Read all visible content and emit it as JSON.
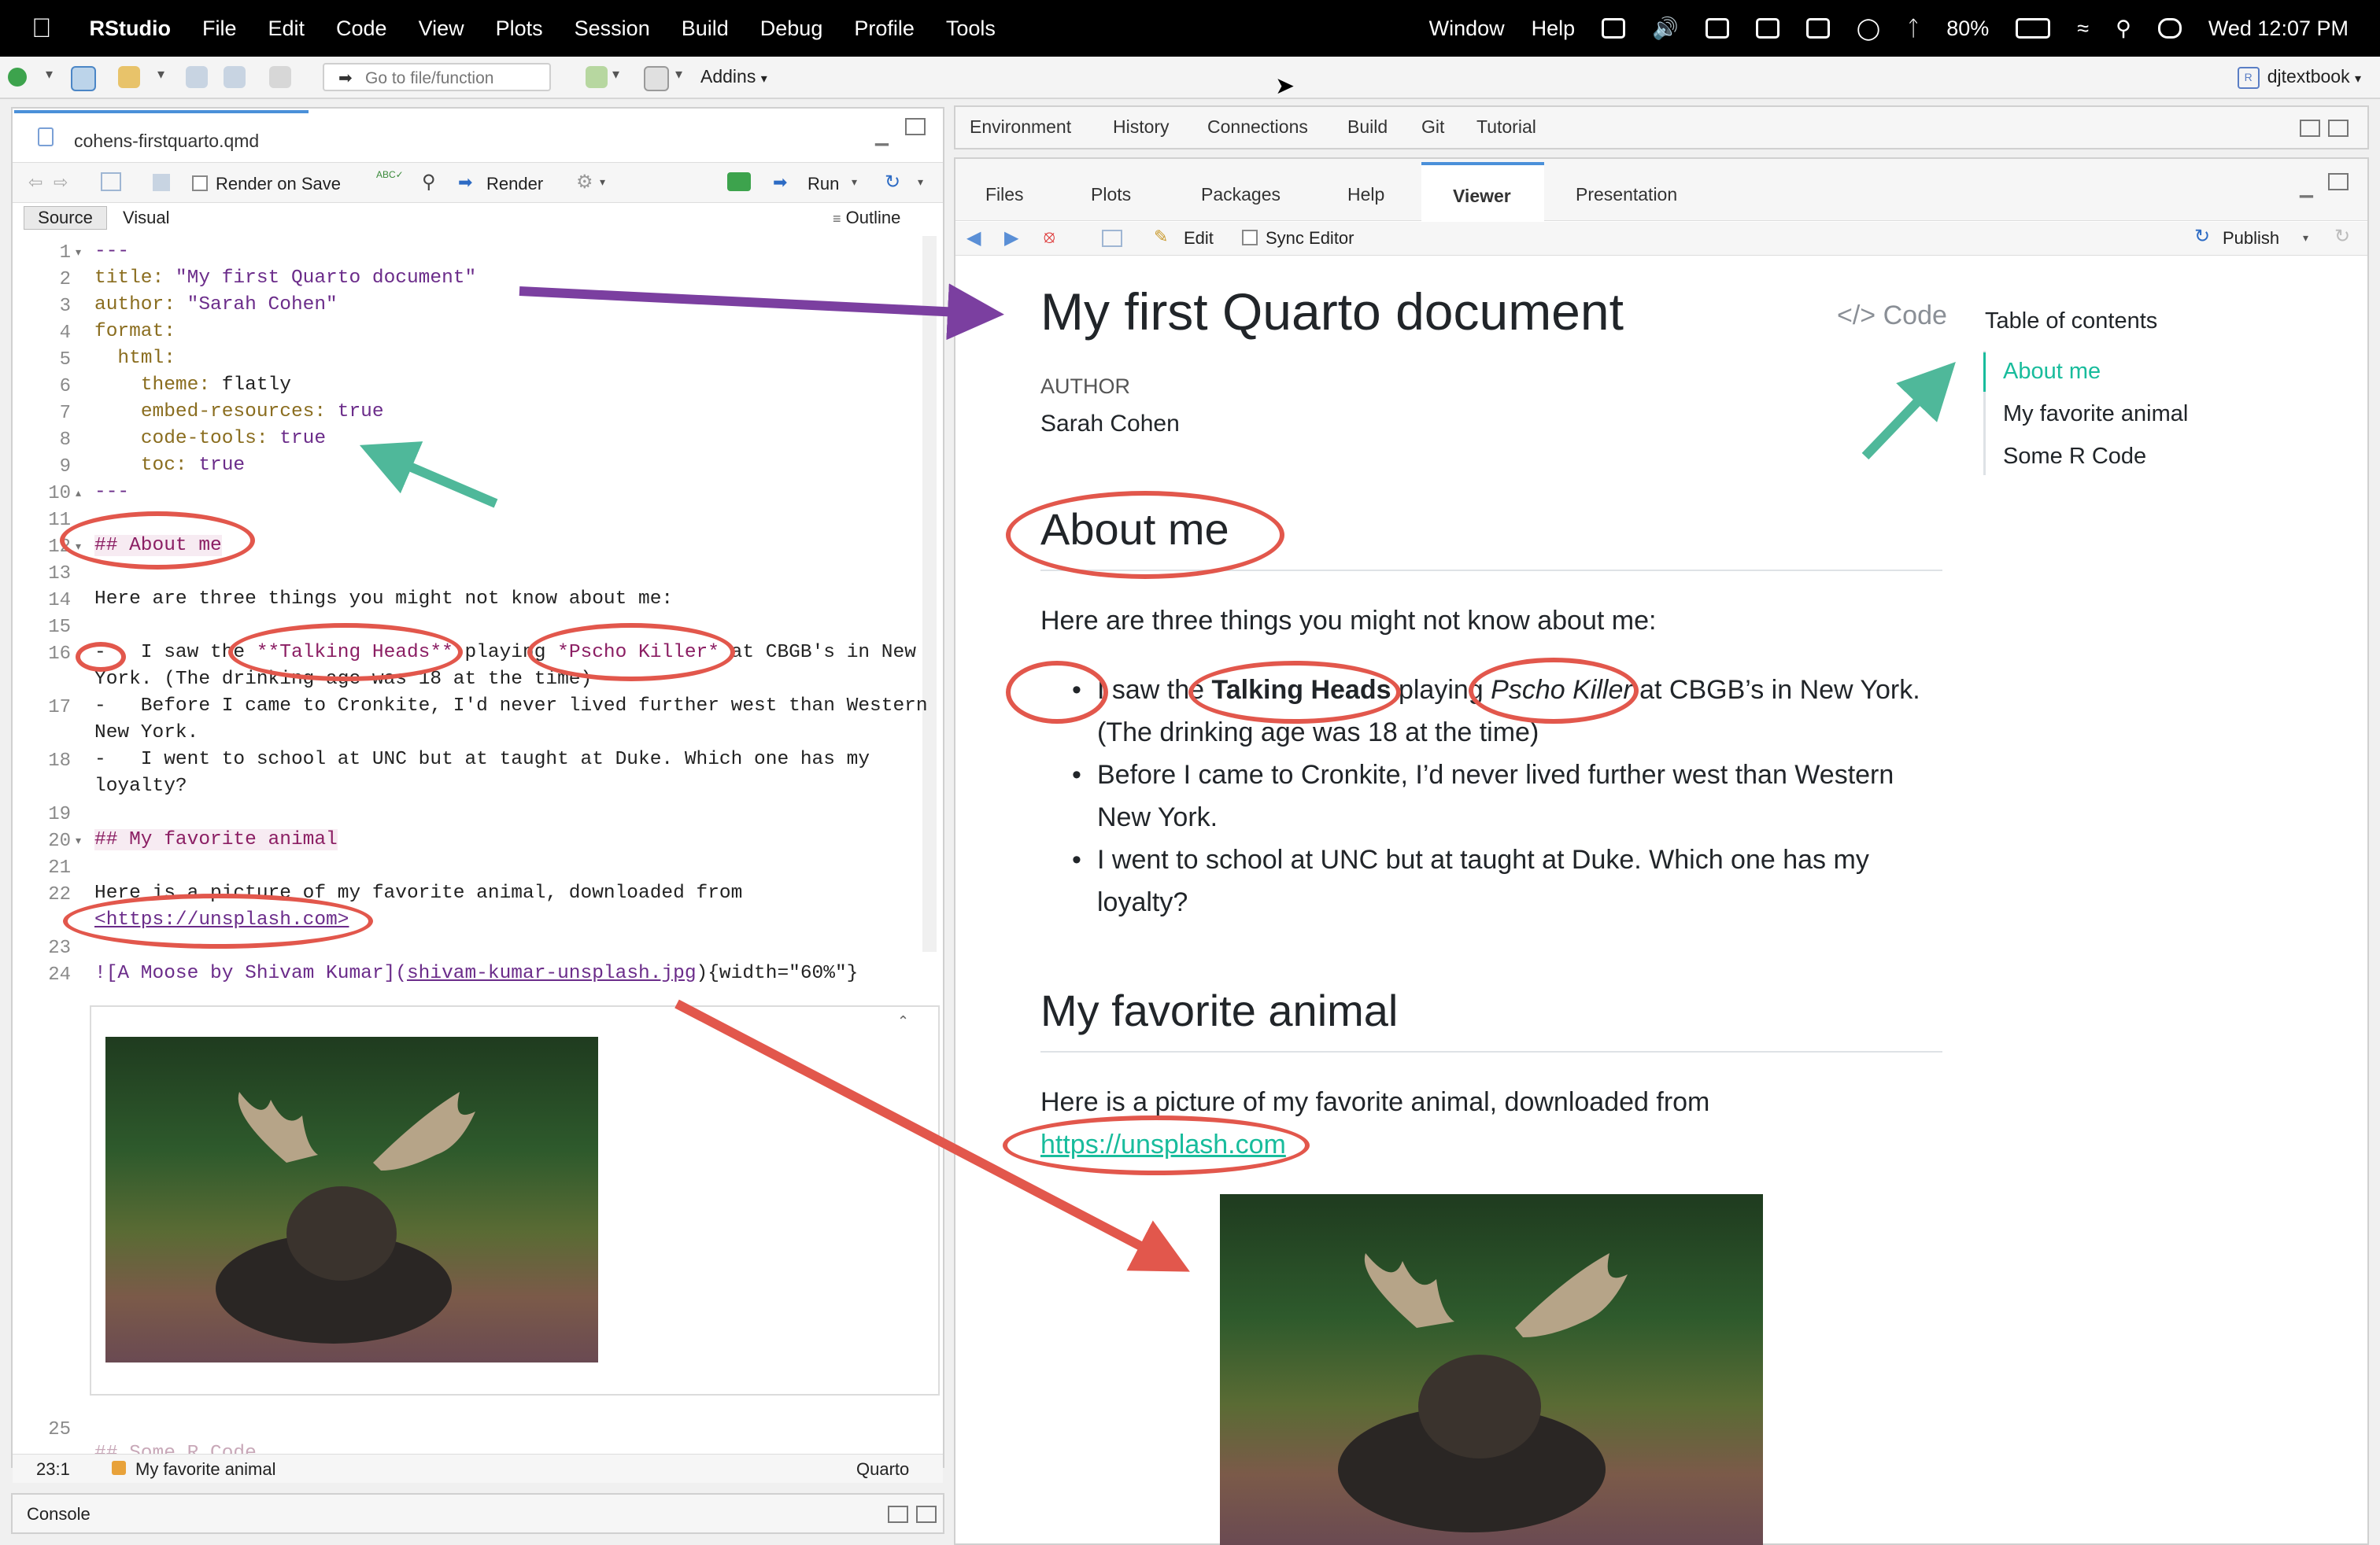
{
  "menubar": {
    "app_name": "RStudio",
    "items": [
      "File",
      "Edit",
      "Code",
      "View",
      "Plots",
      "Session",
      "Build",
      "Debug",
      "Profile",
      "Tools"
    ],
    "right_items": [
      "Window",
      "Help"
    ],
    "battery": "80%",
    "clock": "Wed  12:07 PM"
  },
  "toolbar": {
    "goto_placeholder": "Go to file/function",
    "addins_label": "Addins",
    "project_label": "djtextbook"
  },
  "editor": {
    "file_tab": "cohens-firstquarto.qmd",
    "render_on_save": "Render on Save",
    "render_button": "Render",
    "run_button": "Run",
    "source_tab": "Source",
    "visual_tab": "Visual",
    "outline_button": "Outline",
    "line_numbers": [
      "1",
      "2",
      "3",
      "4",
      "5",
      "6",
      "7",
      "8",
      "9",
      "10",
      "11",
      "12",
      "13",
      "14",
      "15",
      "16",
      "",
      "17",
      "",
      "18",
      "",
      "19",
      "20",
      "21",
      "22",
      "",
      "23",
      "24"
    ],
    "lines": {
      "l1": "---",
      "l2_key": "title:",
      "l2_val": "\"My first Quarto document\"",
      "l3_key": "author:",
      "l3_val": "\"Sarah Cohen\"",
      "l4_key": "format:",
      "l5_key": "html:",
      "l6_key": "theme:",
      "l6_val": "flatly",
      "l7_key": "embed-resources:",
      "l7_val": "true",
      "l8_key": "code-tools:",
      "l8_val": "true",
      "l9_key": "toc:",
      "l9_val": "true",
      "l10": "---",
      "l12": "## About me",
      "l14": "Here are three things you might not know about me:",
      "l16a": "-   I saw the ",
      "l16b": "**Talking Heads**",
      "l16c": " playing ",
      "l16d": "*Pscho Killer*",
      "l16e": " at CBGB's in New",
      "l16f": "York. (The drinking age was 18 at the time)",
      "l17a": "-   Before I came to Cronkite, I'd never lived further west than Western",
      "l17b": "New York.",
      "l18a": "-   I went to school at UNC but at taught at Duke. Which one has my",
      "l18b": "loyalty?",
      "l20": "## My favorite animal",
      "l22a": "Here is a picture of my favorite animal, downloaded from",
      "l22b": "<https://unsplash.com>",
      "l24a": "![A Moose by Shivam Kumar](",
      "l24b": "shivam-kumar-unsplash.jpg",
      "l24c": "){width=\"60%\"}"
    },
    "line25_number": "25",
    "line26_partial": "## Some R Code",
    "status_position": "23:1",
    "status_section": "My favorite animal",
    "status_mode": "Quarto"
  },
  "console": {
    "label": "Console"
  },
  "top_right_tabs": [
    "Environment",
    "History",
    "Connections",
    "Build",
    "Git",
    "Tutorial"
  ],
  "viewer_pane": {
    "tabs": [
      "Files",
      "Plots",
      "Packages",
      "Help",
      "Viewer",
      "Presentation"
    ],
    "active_tab": "Viewer",
    "edit_label": "Edit",
    "sync_label": "Sync Editor",
    "publish_label": "Publish"
  },
  "document": {
    "title": "My first Quarto document",
    "code_label": "Code",
    "author_label": "AUTHOR",
    "author": "Sarah Cohen",
    "h_about": "About me",
    "intro": "Here are three things you might not know about me:",
    "bullet1_a": "I saw the ",
    "bullet1_b": "Talking Heads",
    "bullet1_c": " playing ",
    "bullet1_d": "Pscho Killer",
    "bullet1_e": " at CBGB’s in New York.",
    "bullet1_f": "(The drinking age was 18 at the time)",
    "bullet2_a": "Before I came to Cronkite, I’d never lived further west than Western",
    "bullet2_b": "New York.",
    "bullet3_a": "I went to school at UNC but at taught at Duke. Which one has my",
    "bullet3_b": "loyalty?",
    "h_animal": "My favorite animal",
    "animal_text": "Here is a picture of my favorite animal, downloaded from",
    "animal_link": "https://unsplash.com"
  },
  "toc": {
    "title": "Table of contents",
    "items": [
      "About me",
      "My favorite animal",
      "Some R Code"
    ],
    "active_color": "#18bc9c"
  },
  "colors": {
    "annotation_red": "#e2574c",
    "annotation_teal": "#4fb89a",
    "annotation_purple": "#7b3fa0",
    "link_teal": "#18bc9c"
  }
}
